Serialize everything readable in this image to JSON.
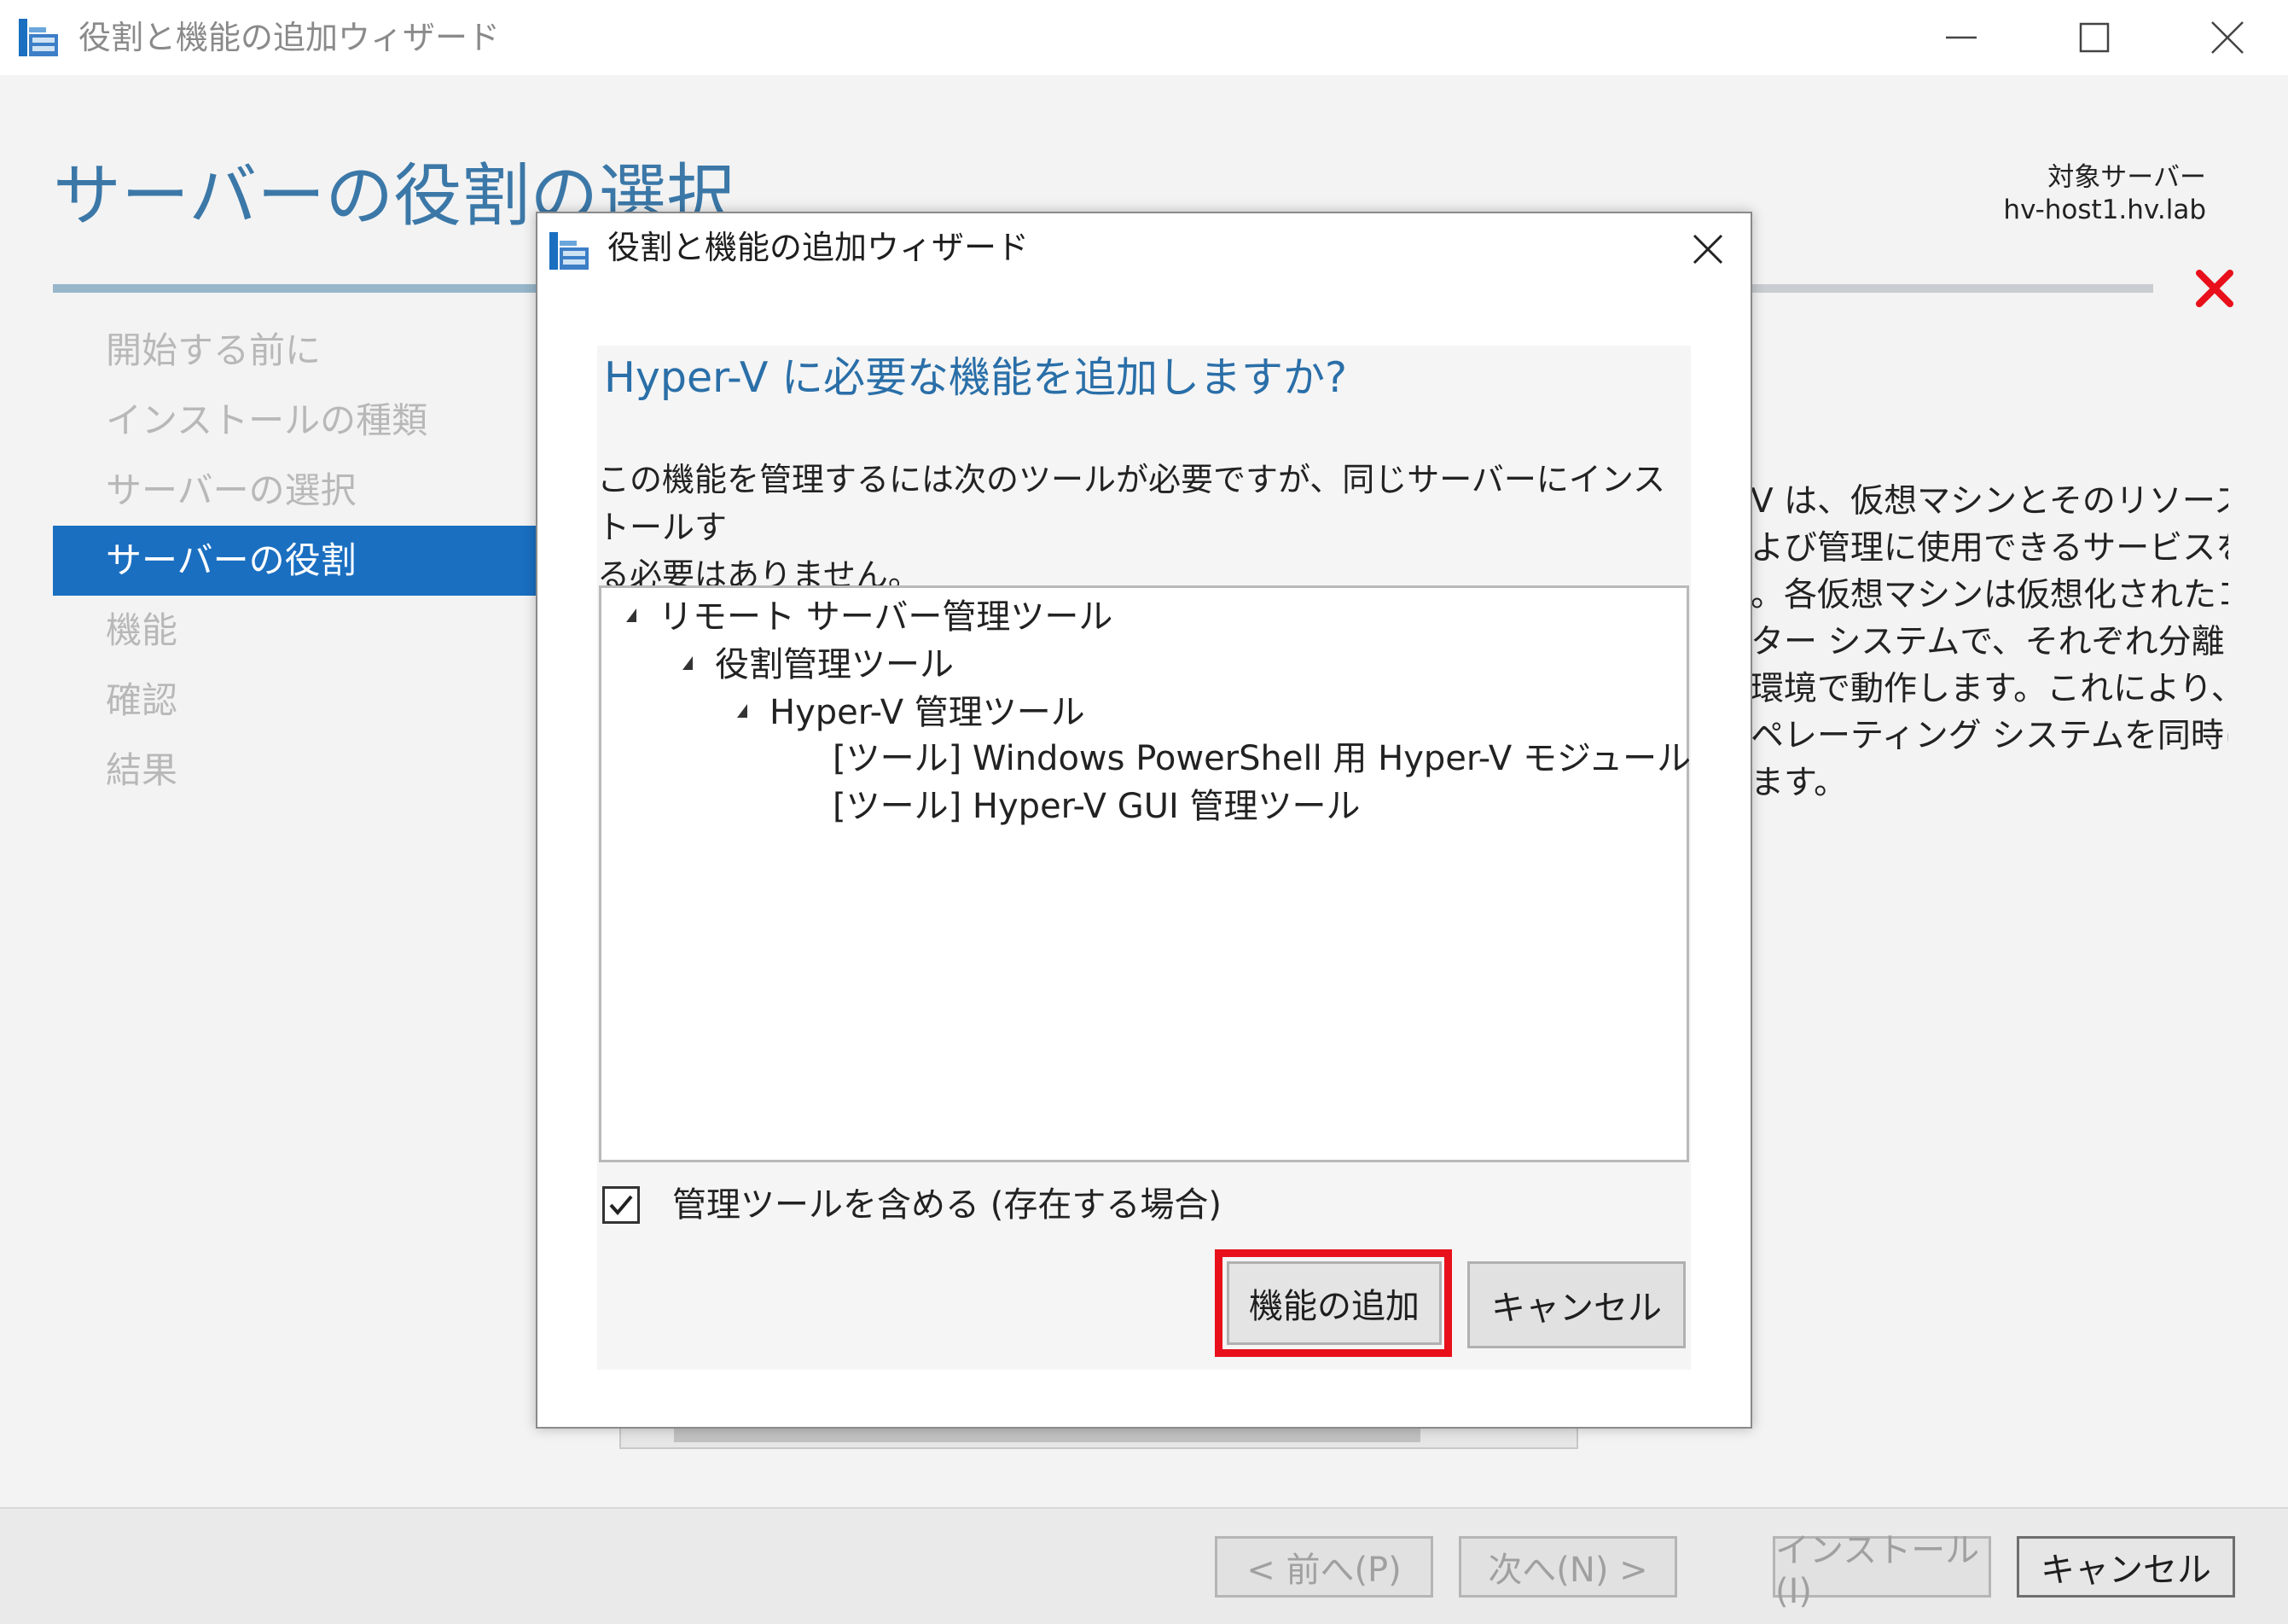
{
  "window": {
    "title": "役割と機能の追加ウィザード",
    "controls": {
      "minimize": "minimize-icon",
      "maximize": "maximize-icon",
      "close": "close-icon"
    }
  },
  "header": {
    "page_title": "サーバーの役割の選択",
    "target_label": "対象サーバー",
    "target_value": "hv-host1.hv.lab"
  },
  "nav": {
    "items": [
      {
        "label": "開始する前に",
        "active": false
      },
      {
        "label": "インストールの種類",
        "active": false
      },
      {
        "label": "サーバーの選択",
        "active": false
      },
      {
        "label": "サーバーの役割",
        "active": true
      },
      {
        "label": "機能",
        "active": false
      },
      {
        "label": "確認",
        "active": false
      },
      {
        "label": "結果",
        "active": false
      }
    ]
  },
  "description": {
    "lines": [
      "V は、仮想マシンとそのリソースの",
      "よび管理に使用できるサービスを提",
      "。各仮想マシンは仮想化されたコ",
      "ター システムで、それぞれ分離され",
      "環境で動作します。これにより、複",
      "ペレーティング システムを同時に実",
      "ます。"
    ]
  },
  "footer": {
    "prev": "< 前へ(P)",
    "next": "次へ(N) >",
    "install": "インストール(I)",
    "cancel": "キャンセル"
  },
  "dialog": {
    "title": "役割と機能の追加ウィザード",
    "heading": "Hyper-V に必要な機能を追加しますか?",
    "message": "この機能を管理するには次のツールが必要ですが、同じサーバーにインストールす\nる必要はありません。",
    "tree": [
      {
        "label": "リモート サーバー管理ツール",
        "expanded": true
      },
      {
        "label": "役割管理ツール",
        "expanded": true
      },
      {
        "label": "Hyper-V 管理ツール",
        "expanded": true
      },
      {
        "label": "[ツール] Windows PowerShell 用 Hyper-V モジュール"
      },
      {
        "label": "[ツール] Hyper-V GUI 管理ツール"
      }
    ],
    "include_tools_label": "管理ツールを含める (存在する場合)",
    "include_tools_checked": true,
    "add_button": "機能の追加",
    "cancel_button": "キャンセル"
  },
  "colors": {
    "accent": "#1a6fc1",
    "title_blue": "#3b78a8",
    "highlight_red": "#e8101a",
    "error_red": "#e8101a"
  }
}
